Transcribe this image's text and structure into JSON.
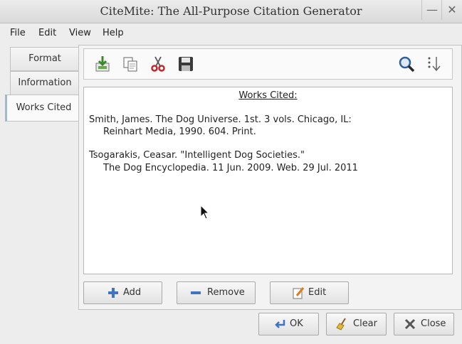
{
  "window": {
    "title": "CiteMite: The All-Purpose Citation Generator"
  },
  "menu": [
    "File",
    "Edit",
    "View",
    "Help"
  ],
  "tabs": [
    {
      "label": "Format"
    },
    {
      "label": "Information"
    },
    {
      "label": "Works Cited"
    }
  ],
  "toolbar": {
    "icons": [
      "import-icon",
      "copy-icon",
      "cut-icon",
      "save-icon",
      "search-icon",
      "sort-icon"
    ]
  },
  "works_cited": {
    "heading": "Works Cited:",
    "entries": [
      {
        "line1": "Smith, James. The Dog Universe. 1st. 3 vols. Chicago, IL:",
        "line2": "Reinhart Media, 1990. 604. Print."
      },
      {
        "line1": "Tsogarakis, Ceasar. \"Intelligent Dog Societies.\"",
        "line2": "The Dog Encyclopedia. 11 Jun. 2009. Web. 29 Jul. 2011"
      }
    ]
  },
  "buttons": {
    "add": "Add",
    "remove": "Remove",
    "edit": "Edit",
    "ok": "OK",
    "clear": "Clear",
    "close": "Close"
  },
  "colors": {
    "active_tab_accent": "#9fb8d4",
    "add_blue": "#3f73c4",
    "cut_red": "#c0262b"
  }
}
